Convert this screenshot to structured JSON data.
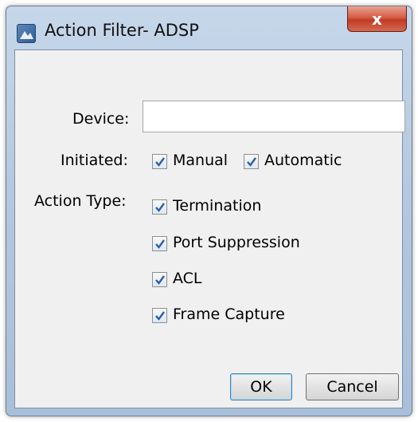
{
  "window": {
    "title": "Action Filter- ADSP",
    "close_label": "x"
  },
  "form": {
    "device_label": "Device:",
    "device_value": "",
    "initiated_label": "Initiated:",
    "initiated_options": [
      {
        "label": "Manual",
        "checked": true
      },
      {
        "label": "Automatic",
        "checked": true
      }
    ],
    "action_type_label": "Action Type:",
    "action_types": [
      {
        "label": "Termination",
        "checked": true
      },
      {
        "label": "Port Suppression",
        "checked": true
      },
      {
        "label": "ACL",
        "checked": true
      },
      {
        "label": "Frame Capture",
        "checked": true
      }
    ]
  },
  "buttons": {
    "ok_label": "OK",
    "cancel_label": "Cancel"
  },
  "colors": {
    "checkmark": "#2b5fa5",
    "title_bar": "#b4c8df",
    "close_button": "#c23a24"
  }
}
